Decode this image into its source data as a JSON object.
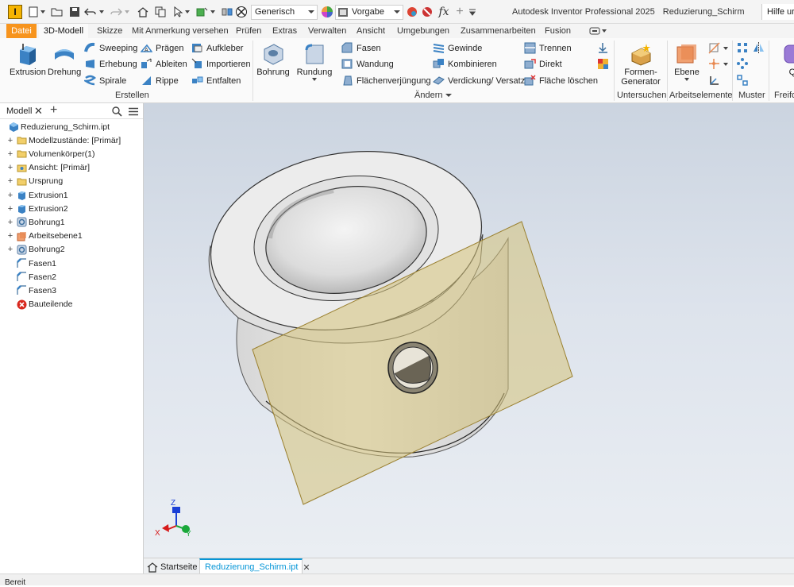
{
  "app": {
    "logo_letter": "I",
    "title": "Autodesk Inventor Professional 2025",
    "document": "Reduzierung_Schirm",
    "help": "Hilfe ur"
  },
  "qat": {
    "material_combo": "Generisch",
    "appearance_combo": "Vorgabe"
  },
  "tabs": [
    "Datei",
    "3D-Modell",
    "Skizze",
    "Mit Anmerkung versehen",
    "Prüfen",
    "Extras",
    "Verwalten",
    "Ansicht",
    "Umgebungen",
    "Zusammenarbeiten",
    "Fusion"
  ],
  "ribbon": {
    "erstellen": {
      "label": "Erstellen",
      "extrusion": "Extrusion",
      "drehung": "Drehung",
      "sweeping": "Sweeping",
      "erhebung": "Erhebung",
      "spirale": "Spirale",
      "praegen": "Prägen",
      "ableiten": "Ableiten",
      "rippe": "Rippe",
      "aufkleber": "Aufkleber",
      "importieren": "Importieren",
      "entfalten": "Entfalten"
    },
    "aendern": {
      "label": "Ändern",
      "bohrung": "Bohrung",
      "rundung": "Rundung",
      "fasen": "Fasen",
      "wandung": "Wandung",
      "flaechenverjuengung": "Flächenverjüngung",
      "gewinde": "Gewinde",
      "kombinieren": "Kombinieren",
      "verdickung": "Verdickung/ Versatz",
      "trennen": "Trennen",
      "direkt": "Direkt",
      "flaeche_loeschen": "Fläche löschen"
    },
    "untersuchen": {
      "label": "Untersuchen",
      "formen_generator_1": "Formen-",
      "formen_generator_2": "Generator"
    },
    "arbeitselemente": {
      "label": "Arbeitselemente",
      "ebene": "Ebene"
    },
    "muster": {
      "label": "Muster"
    },
    "freiform": {
      "label": "Freifo",
      "button": "Qu"
    }
  },
  "browser": {
    "title": "Modell",
    "items": [
      {
        "label": "Reduzierung_Schirm.ipt",
        "expander": "",
        "icon": "part-icon"
      },
      {
        "label": "Modellzustände: [Primär]",
        "expander": "+",
        "icon": "folder-icon"
      },
      {
        "label": "Volumenkörper(1)",
        "expander": "+",
        "icon": "folder-icon"
      },
      {
        "label": "Ansicht: [Primär]",
        "expander": "+",
        "icon": "view-icon"
      },
      {
        "label": "Ursprung",
        "expander": "+",
        "icon": "folder-icon"
      },
      {
        "label": "Extrusion1",
        "expander": "+",
        "icon": "extrusion-icon"
      },
      {
        "label": "Extrusion2",
        "expander": "+",
        "icon": "extrusion-icon"
      },
      {
        "label": "Bohrung1",
        "expander": "+",
        "icon": "hole-icon"
      },
      {
        "label": "Arbeitsebene1",
        "expander": "+",
        "icon": "workplane-icon"
      },
      {
        "label": "Bohrung2",
        "expander": "+",
        "icon": "hole-icon"
      },
      {
        "label": "Fasen1",
        "expander": "",
        "icon": "chamfer-icon"
      },
      {
        "label": "Fasen2",
        "expander": "",
        "icon": "chamfer-icon"
      },
      {
        "label": "Fasen3",
        "expander": "",
        "icon": "chamfer-icon"
      },
      {
        "label": "Bauteilende",
        "expander": "",
        "icon": "end-of-part-icon"
      }
    ]
  },
  "viewport": {
    "axis_x": "X",
    "axis_y": "Y",
    "axis_z": "Z"
  },
  "doc_tabs": {
    "home": "Startseite",
    "active": "Reduzierung_Schirm.ipt"
  },
  "status": "Bereit",
  "colors": {
    "accent_tab": "#f7941d",
    "active_blue": "#0696d7",
    "workplane": "#d6c27a"
  }
}
